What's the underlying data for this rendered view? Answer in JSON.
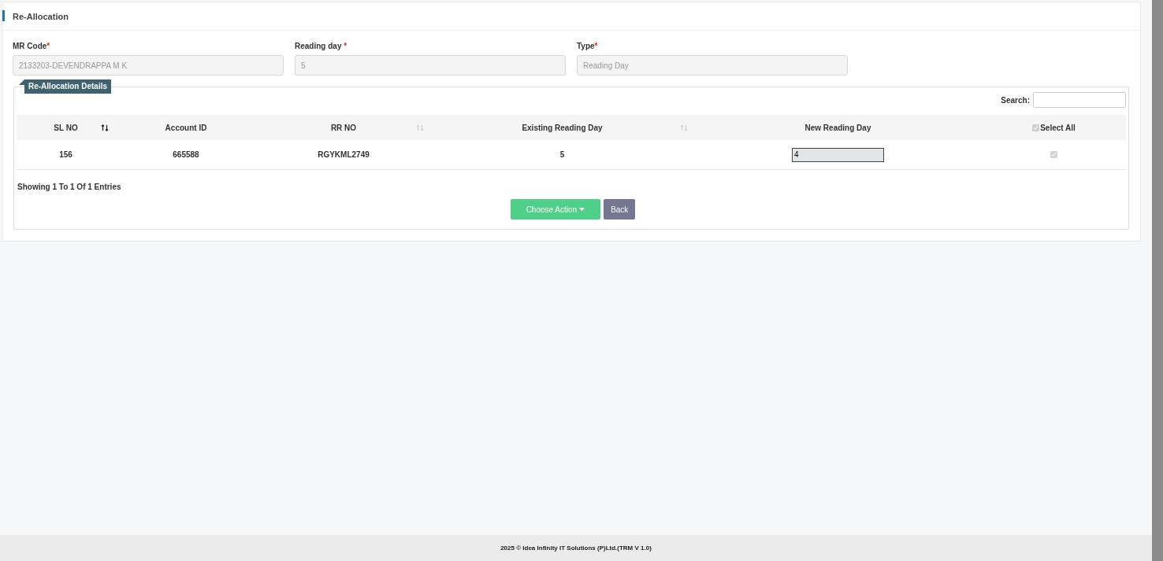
{
  "panel": {
    "title": "Re-Allocation"
  },
  "fields": [
    {
      "label": "MR Code",
      "required_mark": "*",
      "value": "2133203-DEVENDRAPPA M K"
    },
    {
      "label": "Reading day ",
      "required_mark": "*",
      "value": "5"
    },
    {
      "label": "Type",
      "required_mark": "*",
      "value": "Reading Day"
    }
  ],
  "details": {
    "legend": "Re-Allocation Details",
    "search": {
      "label": "Search:"
    },
    "table": {
      "columns": [
        {
          "label": "SL NO",
          "kind": "text",
          "sortable": true,
          "sorted": true
        },
        {
          "label": "Account ID",
          "kind": "text"
        },
        {
          "label": "RR NO",
          "kind": "text",
          "sortable": true,
          "sorted": false
        },
        {
          "label": "Existing Reading Day",
          "kind": "text",
          "sortable": true,
          "sorted": false
        },
        {
          "label": "New Reading Day",
          "kind": "input"
        },
        {
          "label": "Select All",
          "kind": "checkbox",
          "checked": true
        }
      ],
      "rows": [
        {
          "cells": [
            "156",
            "665588",
            "RGYKML2749",
            "5",
            "4"
          ],
          "checked": true
        }
      ]
    },
    "info": "Showing 1 To 1 Of 1 Entries",
    "buttons": [
      {
        "label": "Choose Action",
        "kind": "dropdown"
      },
      {
        "label": "Back",
        "kind": "plain"
      }
    ]
  },
  "footer": "2025 © Idea Infinity IT Solutions (P)Ltd.(TRM V 1.0)"
}
